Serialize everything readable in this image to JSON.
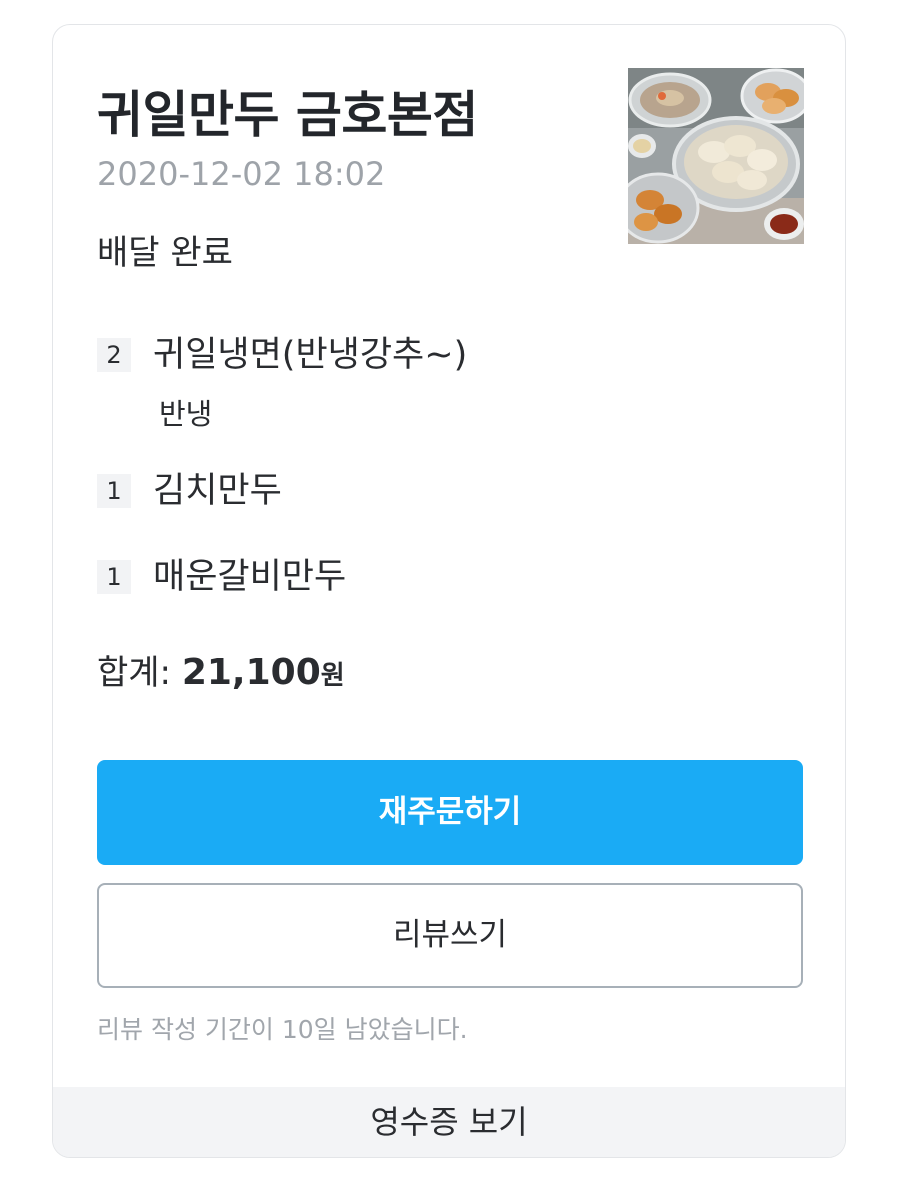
{
  "order": {
    "store_name": "귀일만두 금호본점",
    "date": "2020-12-02 18:02",
    "status": "배달 완료",
    "items": [
      {
        "qty": "2",
        "name": "귀일냉면(반냉강추~)",
        "option": "반냉"
      },
      {
        "qty": "1",
        "name": "김치만두"
      },
      {
        "qty": "1",
        "name": "매운갈비만두"
      }
    ],
    "total_label": "합계: ",
    "total_amount": "21,100",
    "total_unit": "원"
  },
  "actions": {
    "reorder_label": "재주문하기",
    "review_label": "리뷰쓰기",
    "review_note": "리뷰 작성 기간이 10일 남았습니다.",
    "receipt_label": "영수증 보기"
  },
  "colors": {
    "accent": "#1aabf5"
  },
  "icons": {
    "thumbnail": "food-photo"
  }
}
